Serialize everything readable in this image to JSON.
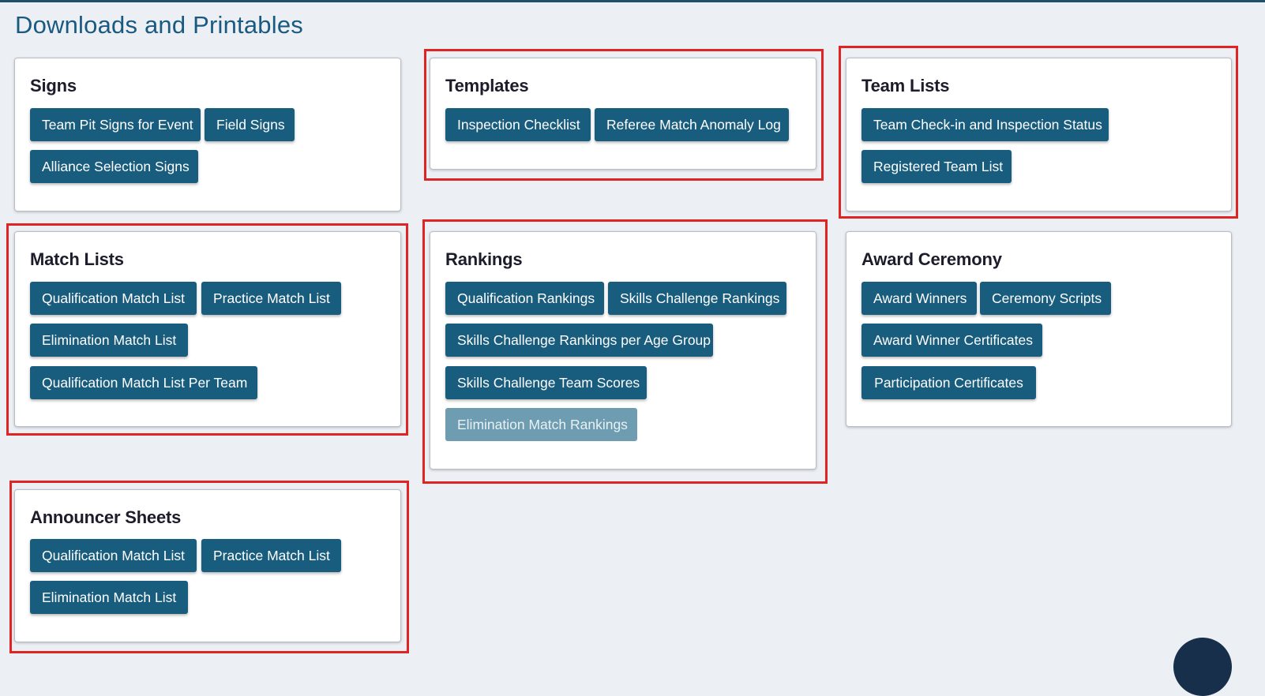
{
  "page": {
    "title": "Downloads and Printables"
  },
  "cards": {
    "signs": {
      "title": "Signs",
      "buttons": [
        "Team Pit Signs for Event",
        "Field Signs",
        "Alliance Selection Signs"
      ]
    },
    "templates": {
      "title": "Templates",
      "buttons": [
        "Inspection Checklist",
        "Referee Match Anomaly Log"
      ]
    },
    "team_lists": {
      "title": "Team Lists",
      "buttons": [
        "Team Check-in and Inspection Status",
        "Registered Team List"
      ]
    },
    "match_lists": {
      "title": "Match Lists",
      "buttons": [
        "Qualification Match List",
        "Practice Match List",
        "Elimination Match List",
        "Qualification Match List Per Team"
      ]
    },
    "rankings": {
      "title": "Rankings",
      "buttons": [
        "Qualification Rankings",
        "Skills Challenge Rankings",
        "Skills Challenge Rankings per Age Group",
        "Skills Challenge Team Scores",
        "Elimination Match Rankings"
      ],
      "disabled": [
        "Elimination Match Rankings"
      ]
    },
    "award_ceremony": {
      "title": "Award Ceremony",
      "buttons": [
        "Award Winners",
        "Ceremony Scripts",
        "Award Winner Certificates",
        "Participation Certificates"
      ]
    },
    "announcer_sheets": {
      "title": "Announcer Sheets",
      "buttons": [
        "Qualification Match List",
        "Practice Match List",
        "Elimination Match List"
      ]
    }
  },
  "highlighted_cards": [
    "templates",
    "team_lists",
    "match_lists",
    "rankings",
    "announcer_sheets"
  ],
  "colors": {
    "background": "#ecf0f5",
    "title": "#1b5a80",
    "button": "#185c7e",
    "button_disabled": "#6e9db2",
    "highlight": "#e02424"
  }
}
